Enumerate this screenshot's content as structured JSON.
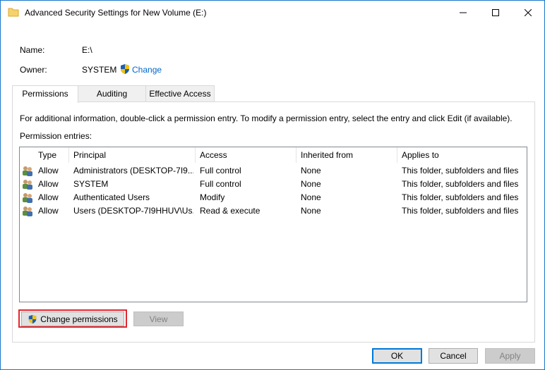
{
  "window": {
    "title": "Advanced Security Settings for New Volume (E:)",
    "accent_color": "#1979ca"
  },
  "info": {
    "name_label": "Name:",
    "name_value": "E:\\",
    "owner_label": "Owner:",
    "owner_value": "SYSTEM",
    "change_link": "Change"
  },
  "tabs": [
    {
      "label": "Permissions",
      "active": true
    },
    {
      "label": "Auditing",
      "active": false
    },
    {
      "label": "Effective Access",
      "active": false
    }
  ],
  "permissions": {
    "instructions": "For additional information, double-click a permission entry. To modify a permission entry, select the entry and click Edit (if available).",
    "entries_label": "Permission entries:",
    "columns": [
      "Type",
      "Principal",
      "Access",
      "Inherited from",
      "Applies to"
    ],
    "rows": [
      {
        "type": "Allow",
        "principal": "Administrators (DESKTOP-7I9...",
        "access": "Full control",
        "inherited": "None",
        "applies": "This folder, subfolders and files"
      },
      {
        "type": "Allow",
        "principal": "SYSTEM",
        "access": "Full control",
        "inherited": "None",
        "applies": "This folder, subfolders and files"
      },
      {
        "type": "Allow",
        "principal": "Authenticated Users",
        "access": "Modify",
        "inherited": "None",
        "applies": "This folder, subfolders and files"
      },
      {
        "type": "Allow",
        "principal": "Users (DESKTOP-7I9HHUV\\Us...",
        "access": "Read & execute",
        "inherited": "None",
        "applies": "This folder, subfolders and files"
      }
    ],
    "change_permissions_button": "Change permissions",
    "view_button": "View"
  },
  "footer": {
    "ok": "OK",
    "cancel": "Cancel",
    "apply": "Apply"
  },
  "icons": {
    "title": "folder-icon",
    "owner_change": "uac-shield-icon",
    "row": "users-icon"
  }
}
